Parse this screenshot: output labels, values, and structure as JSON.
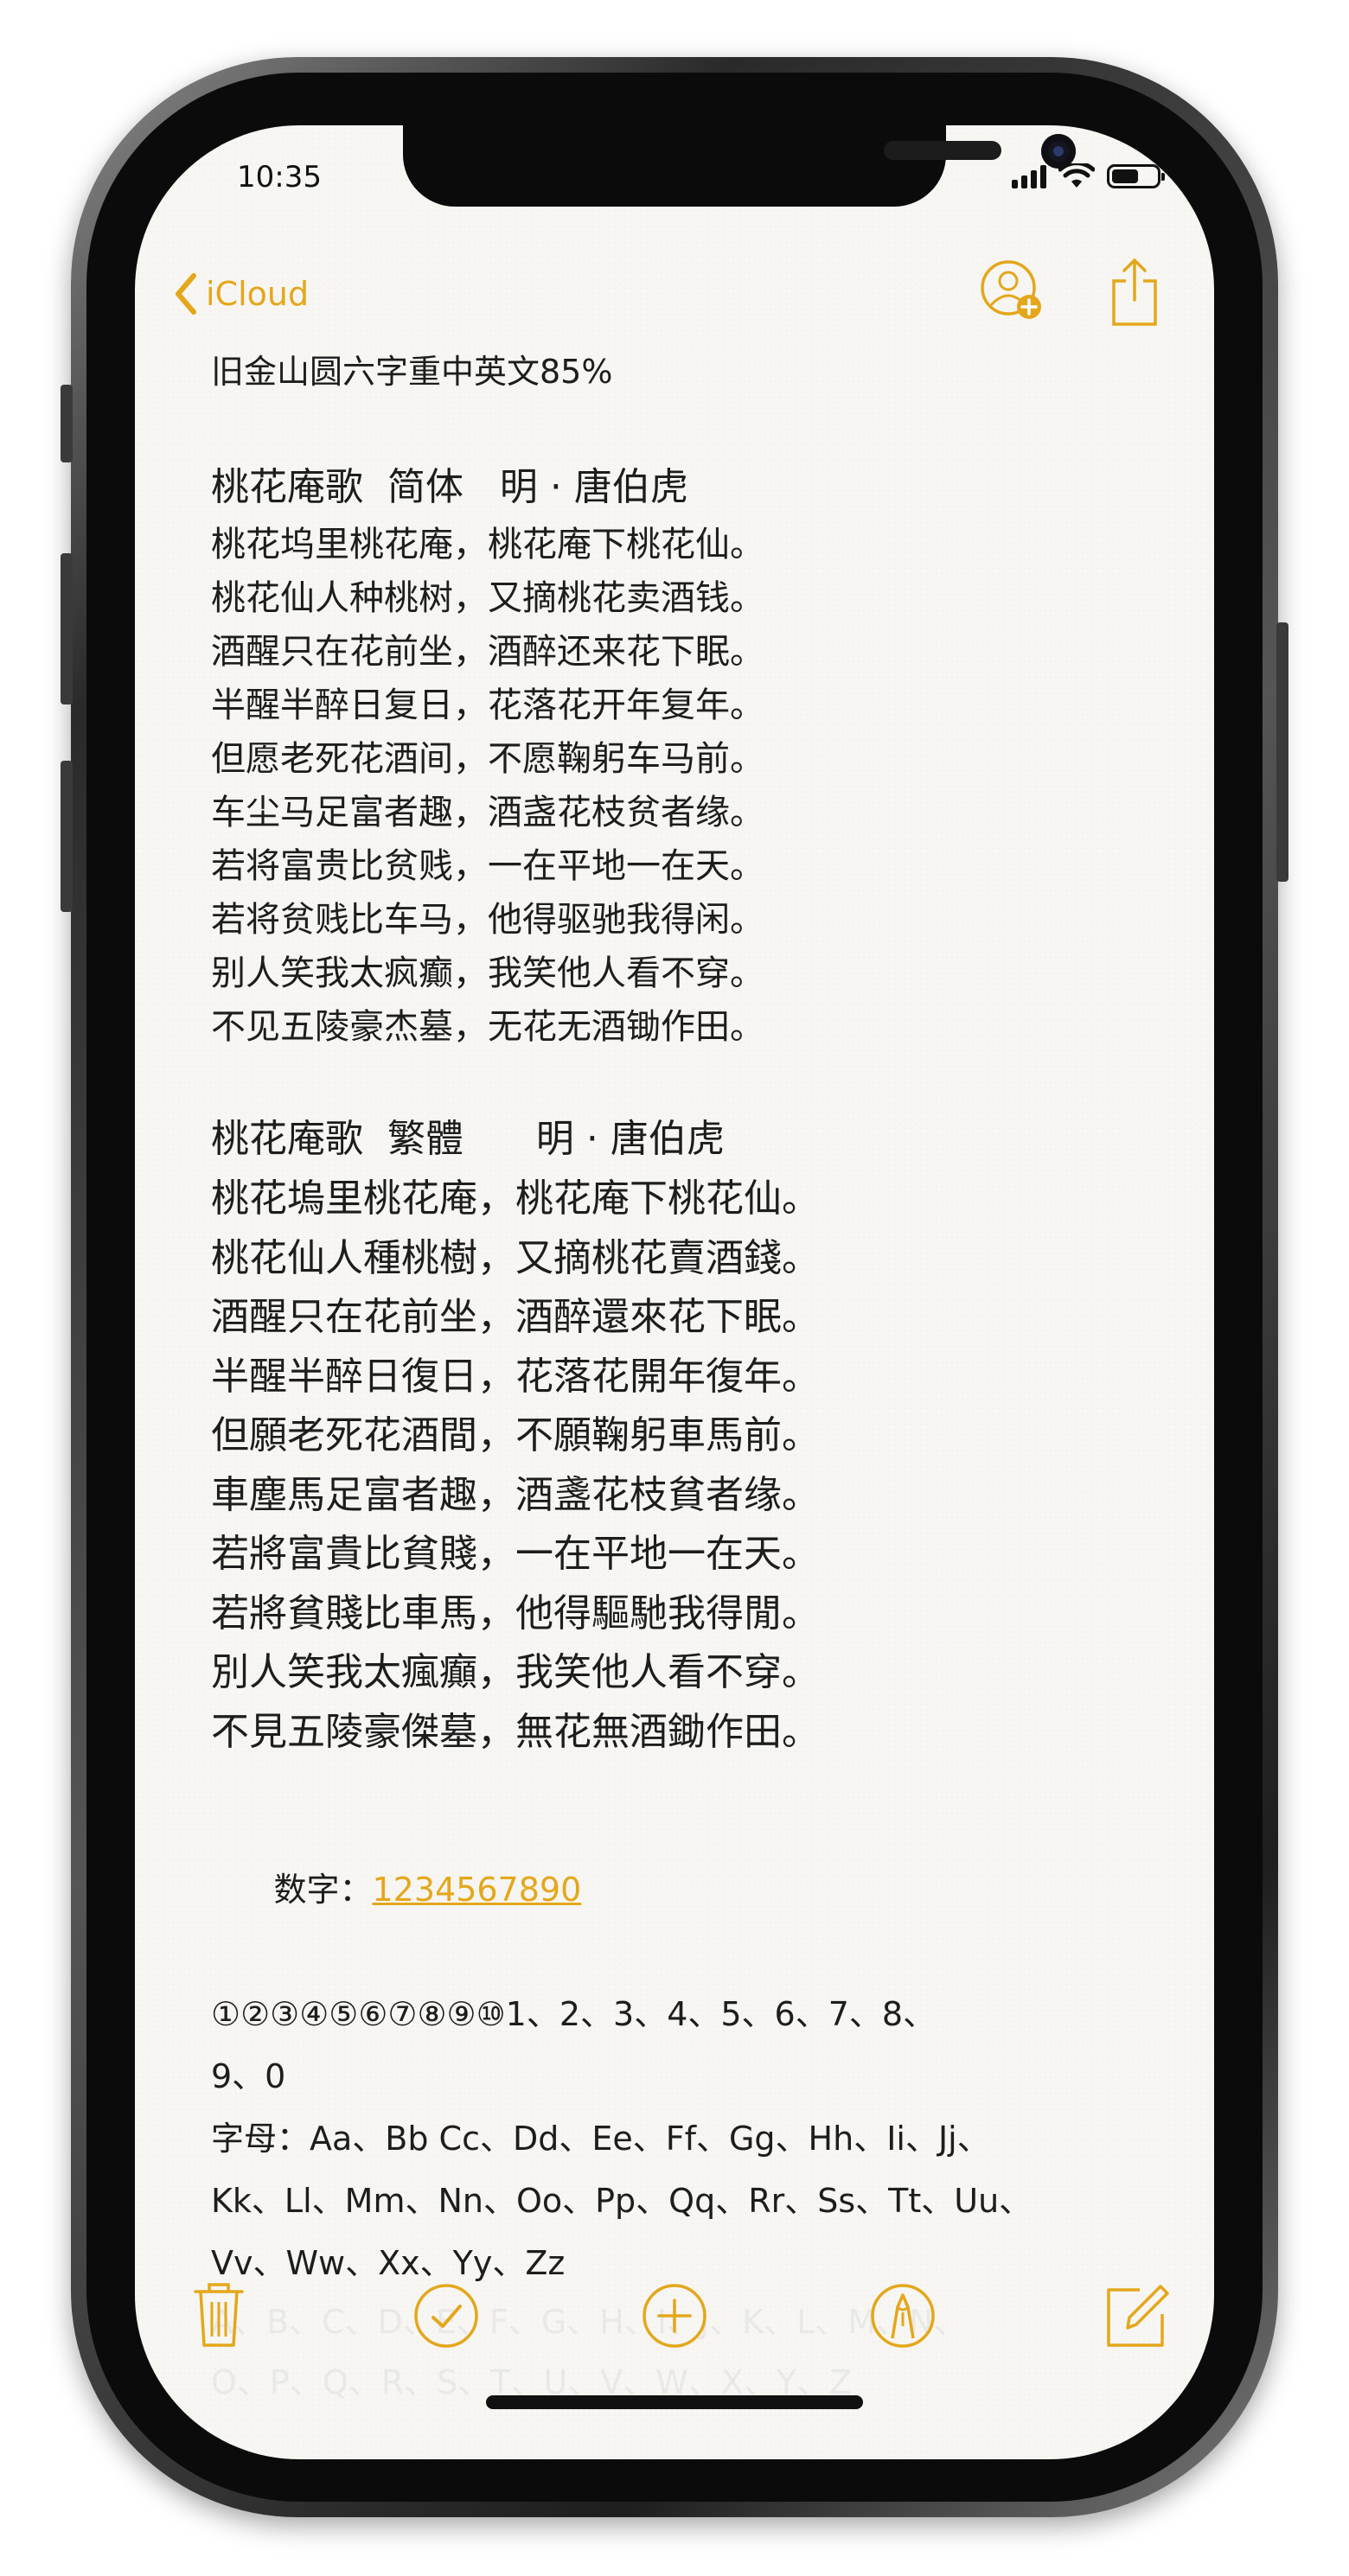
{
  "status_bar": {
    "time": "10:35",
    "battery_level": 0.6,
    "signal_bars": 4,
    "icons": [
      "signal-icon",
      "wifi-icon",
      "battery-icon"
    ]
  },
  "nav": {
    "back_label": "iCloud",
    "icons": [
      "chevron-left-icon",
      "add-person-icon",
      "share-icon"
    ],
    "accent_color": "#e4a71b"
  },
  "note": {
    "first_line": "旧金山圆六字重中英文85%",
    "simplified": {
      "title": "桃花庵歌  简体   明 · 唐伯虎",
      "lines": [
        "桃花坞里桃花庵，桃花庵下桃花仙。",
        "桃花仙人种桃树，又摘桃花卖酒钱。",
        "酒醒只在花前坐，酒醉还来花下眠。",
        "半醒半醉日复日，花落花开年复年。",
        "但愿老死花酒间，不愿鞠躬车马前。",
        "车尘马足富者趣，酒盏花枝贫者缘。",
        "若将富贵比贫贱，一在平地一在天。",
        "若将贫贱比车马，他得驱驰我得闲。",
        "别人笑我太疯癫，我笑他人看不穿。",
        "不见五陵豪杰墓，无花无酒锄作田。"
      ]
    },
    "traditional": {
      "title": "桃花庵歌  繁體      明 · 唐伯虎",
      "lines": [
        "桃花塢里桃花庵，桃花庵下桃花仙。",
        "桃花仙人種桃樹，又摘桃花賣酒錢。",
        "酒醒只在花前坐，酒醉還來花下眠。",
        "半醒半醉日復日，花落花開年復年。",
        "但願老死花酒間，不願鞠躬車馬前。",
        "車塵馬足富者趣，酒盞花枝貧者缘。",
        "若將富貴比貧賤，一在平地一在天。",
        "若將貧賤比車馬，他得驅馳我得閒。",
        "別人笑我太瘋癲，我笑他人看不穿。",
        "不見五陵豪傑墓，無花無酒鋤作田。"
      ]
    },
    "numbers_label": "数字：",
    "numbers_link": "1234567890",
    "numbers_line1": "①②③④⑤⑥⑦⑧⑨⑩1、2、3、4、5、6、7、8、",
    "numbers_line2": "9、0",
    "letters_line1": "字母：Aa、Bb Cc、Dd、Ee、Ff、Gg、Hh、Ii、Jj、",
    "letters_line2": "Kk、Ll、Mm、Nn、Oo、Pp、Qq、Rr、Ss、Tt、Uu、",
    "letters_line3": "Vv、Ww、Xx、Yy、Zz",
    "ghost_line1": "A、B、C、D、E、F、G、H、I、J、K、L、M、N、",
    "ghost_line2": "O、P、Q、R、S、T、U、V、W、X、Y、Z"
  },
  "toolbar": {
    "icons": [
      "trash-icon",
      "checklist-icon",
      "add-icon",
      "markup-icon",
      "compose-icon"
    ]
  }
}
